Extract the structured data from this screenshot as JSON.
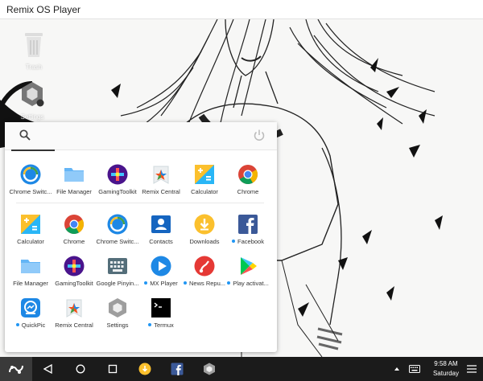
{
  "window": {
    "title": "Remix OS Player"
  },
  "desktop": {
    "icons": [
      {
        "label": "Trash",
        "icon": "trash-icon"
      },
      {
        "label": "Settings",
        "icon": "settings-icon"
      }
    ]
  },
  "launcher": {
    "search_icon": "search-icon",
    "power_icon": "power-icon",
    "recent_apps": [
      {
        "label": "Chrome Switc...",
        "icon": "chrome-switch-icon"
      },
      {
        "label": "File Manager",
        "icon": "file-manager-icon"
      },
      {
        "label": "GamingToolkit",
        "icon": "gaming-toolkit-icon"
      },
      {
        "label": "Remix Central",
        "icon": "remix-central-icon"
      },
      {
        "label": "Calculator",
        "icon": "calculator-icon"
      },
      {
        "label": "Chrome",
        "icon": "chrome-icon"
      }
    ],
    "all_apps": [
      {
        "label": "Calculator",
        "icon": "calculator-icon",
        "new": false
      },
      {
        "label": "Chrome",
        "icon": "chrome-icon",
        "new": false
      },
      {
        "label": "Chrome Switc...",
        "icon": "chrome-switch-icon",
        "new": false
      },
      {
        "label": "Contacts",
        "icon": "contacts-icon",
        "new": false
      },
      {
        "label": "Downloads",
        "icon": "downloads-icon",
        "new": false
      },
      {
        "label": "Facebook",
        "icon": "facebook-icon",
        "new": true
      },
      {
        "label": "File Manager",
        "icon": "file-manager-icon",
        "new": false
      },
      {
        "label": "GamingToolkit",
        "icon": "gaming-toolkit-icon",
        "new": false
      },
      {
        "label": "Google Pinyin...",
        "icon": "google-pinyin-icon",
        "new": false
      },
      {
        "label": "MX Player",
        "icon": "mx-player-icon",
        "new": true
      },
      {
        "label": "News Repu...",
        "icon": "news-republic-icon",
        "new": true
      },
      {
        "label": "Play activat...",
        "icon": "play-store-icon",
        "new": true
      },
      {
        "label": "QuickPic",
        "icon": "quickpic-icon",
        "new": true
      },
      {
        "label": "Remix Central",
        "icon": "remix-central-icon",
        "new": false
      },
      {
        "label": "Settings",
        "icon": "settings-icon",
        "new": false
      },
      {
        "label": "Termux",
        "icon": "termux-icon",
        "new": true
      }
    ]
  },
  "taskbar": {
    "start_icon": "remix-start-icon",
    "clock_time": "9:58 AM",
    "clock_day": "Saturday"
  },
  "colors": {
    "taskbar": "#1b1b1b",
    "accent": "#2196f3",
    "new_app_dot": "#2196f3"
  }
}
